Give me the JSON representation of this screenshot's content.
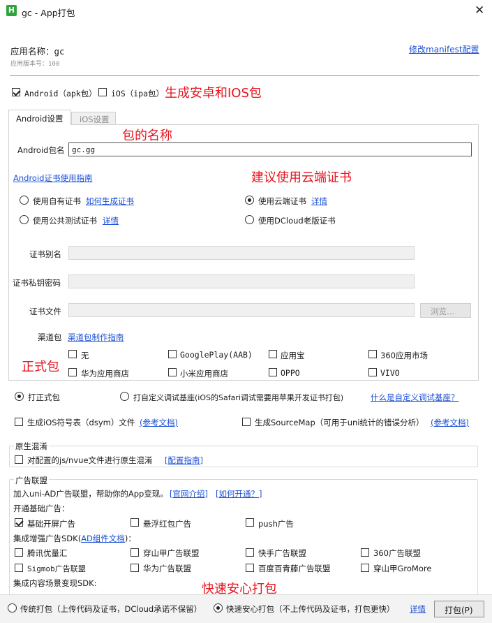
{
  "window": {
    "title": "gc - App打包",
    "icon": "H"
  },
  "app": {
    "name_label": "应用名称：gc",
    "version_label": "应用版本号：100",
    "manifest_link": "修改manifest配置"
  },
  "targets": {
    "android": {
      "label": "Android（apk包）",
      "checked": true
    },
    "ios": {
      "label": "iOS（ipa包）",
      "checked": false
    },
    "note": "生成安卓和IOS包"
  },
  "tabs": [
    {
      "label": "Android设置",
      "active": true
    },
    {
      "label": "iOS设置",
      "active": false
    }
  ],
  "android": {
    "package_label": "Android包名",
    "package_value": "gc.gg",
    "package_note": "包的名称",
    "cert_guide_link": "Android证书使用指南",
    "cert_note": "建议使用云端证书",
    "cert_options": {
      "own": {
        "label": "使用自有证书",
        "link": "如何生成证书"
      },
      "cloud": {
        "label": "使用云端证书",
        "link": "详情",
        "checked": true
      },
      "public": {
        "label": "使用公共测试证书",
        "link": "详情"
      },
      "dcloud": {
        "label": "使用DCloud老版证书"
      }
    },
    "cert_alias_label": "证书别名",
    "cert_password_label": "证书私钥密码",
    "cert_file_label": "证书文件",
    "browse_label": "浏览...",
    "channel_label": "渠道包",
    "channel_link": "渠道包制作指南",
    "channel_note": "正式包",
    "channels": [
      "无",
      "GooglePlay(AAB)",
      "应用宝",
      "360应用市场",
      "华为应用商店",
      "小米应用商店",
      "OPPO",
      "VIVO"
    ]
  },
  "build_type": {
    "formal": {
      "label": "打正式包",
      "checked": true
    },
    "custom": {
      "label": "打自定义调试基座(iOS的Safari调试需要用苹果开发证书打包)",
      "link": "什么是自定义调试基座？"
    }
  },
  "symbols": {
    "ios_dsym": {
      "label": "生成iOS符号表（dsym）文件",
      "link": "(参考文档)"
    },
    "sourcemap": {
      "label": "生成SourceMap（可用于uni统计的错误分析）",
      "link": "(参考文档)"
    }
  },
  "obfuscation": {
    "title": "原生混淆",
    "option": "对配置的js/nvue文件进行原生混淆",
    "link": "[配置指南]"
  },
  "ads": {
    "title": "广告联盟",
    "intro": "加入uni-AD广告联盟，帮助你的App变现。",
    "intro_link1": "[官网介绍]",
    "intro_link2": "[如何开通？]",
    "basic_title": "开通基础广告：",
    "basic": [
      {
        "label": "基础开屏广告",
        "checked": true
      },
      {
        "label": "悬浮红包广告",
        "checked": false
      },
      {
        "label": "push广告",
        "checked": false
      }
    ],
    "sdk_title_prefix": "集成增强广告SDK(",
    "sdk_title_link": "AD组件文档",
    "sdk_title_suffix": ")：",
    "sdk": [
      "腾讯优量汇",
      "穿山甲广告联盟",
      "快手广告联盟",
      "360广告联盟",
      "Sigmob广告联盟",
      "华为广告联盟",
      "百度百青藤广告联盟",
      "穿山甲GroMore"
    ],
    "content_title": "集成内容场景变现SDK:",
    "fast_note": "快速安心打包"
  },
  "footer": {
    "traditional": "传统打包（上传代码及证书，DCloud承诺不保留）",
    "fast": "快速安心打包（不上传代码及证书，打包更快）",
    "fast_checked": true,
    "detail_link": "详情",
    "build_button": "打包(P)"
  }
}
